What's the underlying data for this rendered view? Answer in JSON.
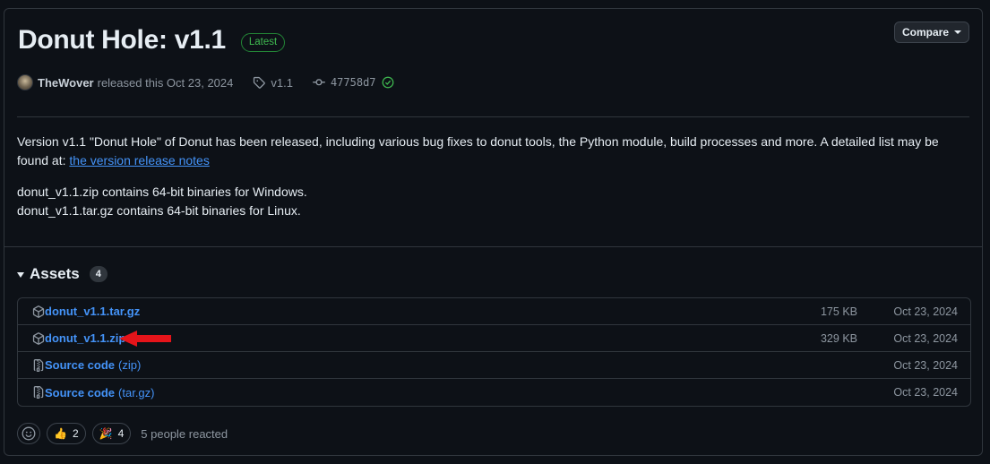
{
  "release": {
    "title": "Donut Hole: v1.1",
    "badge": "Latest",
    "compare_label": "Compare",
    "author": "TheWover",
    "released_text": "released this Oct 23, 2024",
    "tag": "v1.1",
    "commit": "47758d7"
  },
  "body": {
    "paragraph1_prefix": "Version v1.1 \"Donut Hole\" of Donut has been released, including various bug fixes to donut tools, the Python module, build processes and more. A detailed list may be found at: ",
    "paragraph1_link": "the version release notes",
    "line2": "donut_v1.1.zip contains 64-bit binaries for Windows.",
    "line3": "donut_v1.1.tar.gz contains 64-bit binaries for Linux."
  },
  "assets": {
    "title": "Assets",
    "count": "4",
    "items": [
      {
        "name": "donut_v1.1.tar.gz",
        "sub": "",
        "size": "175 KB",
        "date": "Oct 23, 2024",
        "icon": "package-icon"
      },
      {
        "name": "donut_v1.1.zip",
        "sub": "",
        "size": "329 KB",
        "date": "Oct 23, 2024",
        "icon": "package-icon"
      },
      {
        "name": "Source code",
        "sub": "(zip)",
        "size": "",
        "date": "Oct 23, 2024",
        "icon": "file-zip-icon"
      },
      {
        "name": "Source code",
        "sub": "(tar.gz)",
        "size": "",
        "date": "Oct 23, 2024",
        "icon": "file-zip-icon"
      }
    ]
  },
  "reactions": {
    "thumbs_count": "2",
    "tada_count": "4",
    "summary": "5 people reacted"
  },
  "colors": {
    "background": "#0d1117",
    "link": "#4493f8",
    "latest_green": "#3fb950",
    "annotation_arrow": "#e5141a"
  }
}
